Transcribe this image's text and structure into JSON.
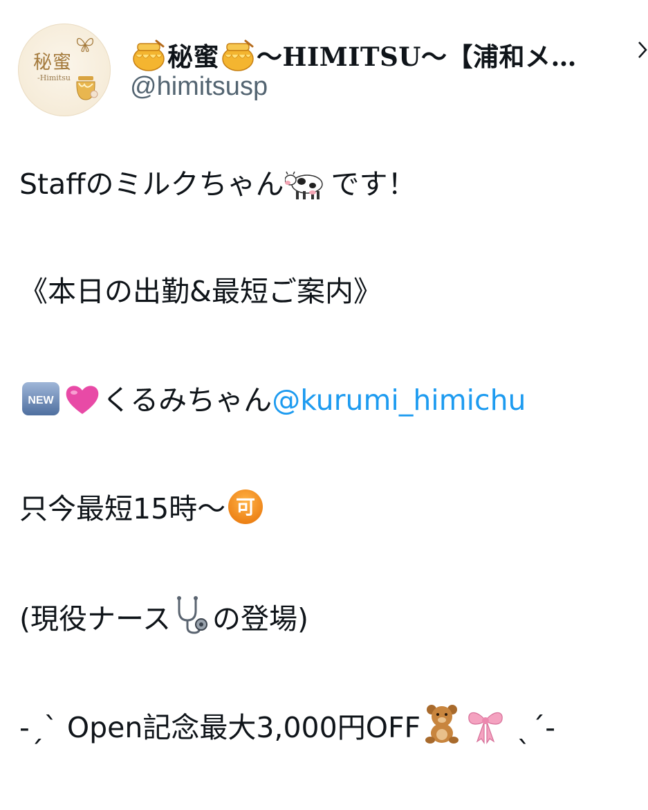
{
  "profile": {
    "avatar_brand": "秘蜜",
    "avatar_sub": "-Himitsu",
    "display_name_part1": "秘蜜",
    "display_name_part2": "〜HIMITSU〜【浦和メ…",
    "handle": "@himitsusp"
  },
  "tweet": {
    "line1_a": "Staffのミルクちゃん",
    "line1_b": "です！",
    "line2": "《本日の出勤&最短ご案内》",
    "line3_a": "くるみちゃん",
    "line3_mention": "@kurumi_himichu",
    "line4_a": "只今最短15時〜",
    "line5_a": "(現役ナース",
    "line5_b": "の登場)",
    "line6_a": "-ˏˋ Open記念最大3,000円OFF",
    "line6_b": " ˎˊ-",
    "new_badge": "NEW",
    "ka_badge": "可"
  },
  "icons": {
    "honey": "honey-pot-icon",
    "cow": "cow-icon",
    "new": "new-button-icon",
    "heart": "pink-heart-icon",
    "ka": "japanese-acceptable-button-icon",
    "stethoscope": "stethoscope-icon",
    "bear": "teddy-bear-icon",
    "ribbon": "ribbon-icon",
    "chevron": "chevron-right-icon",
    "butterfly": "butterfly-icon"
  },
  "colors": {
    "text": "#0f1419",
    "handle": "#536471",
    "mention": "#1d9bf0",
    "heart": "#e84aa6",
    "ka": "#f28a1a",
    "new": "#4b7bd1"
  }
}
